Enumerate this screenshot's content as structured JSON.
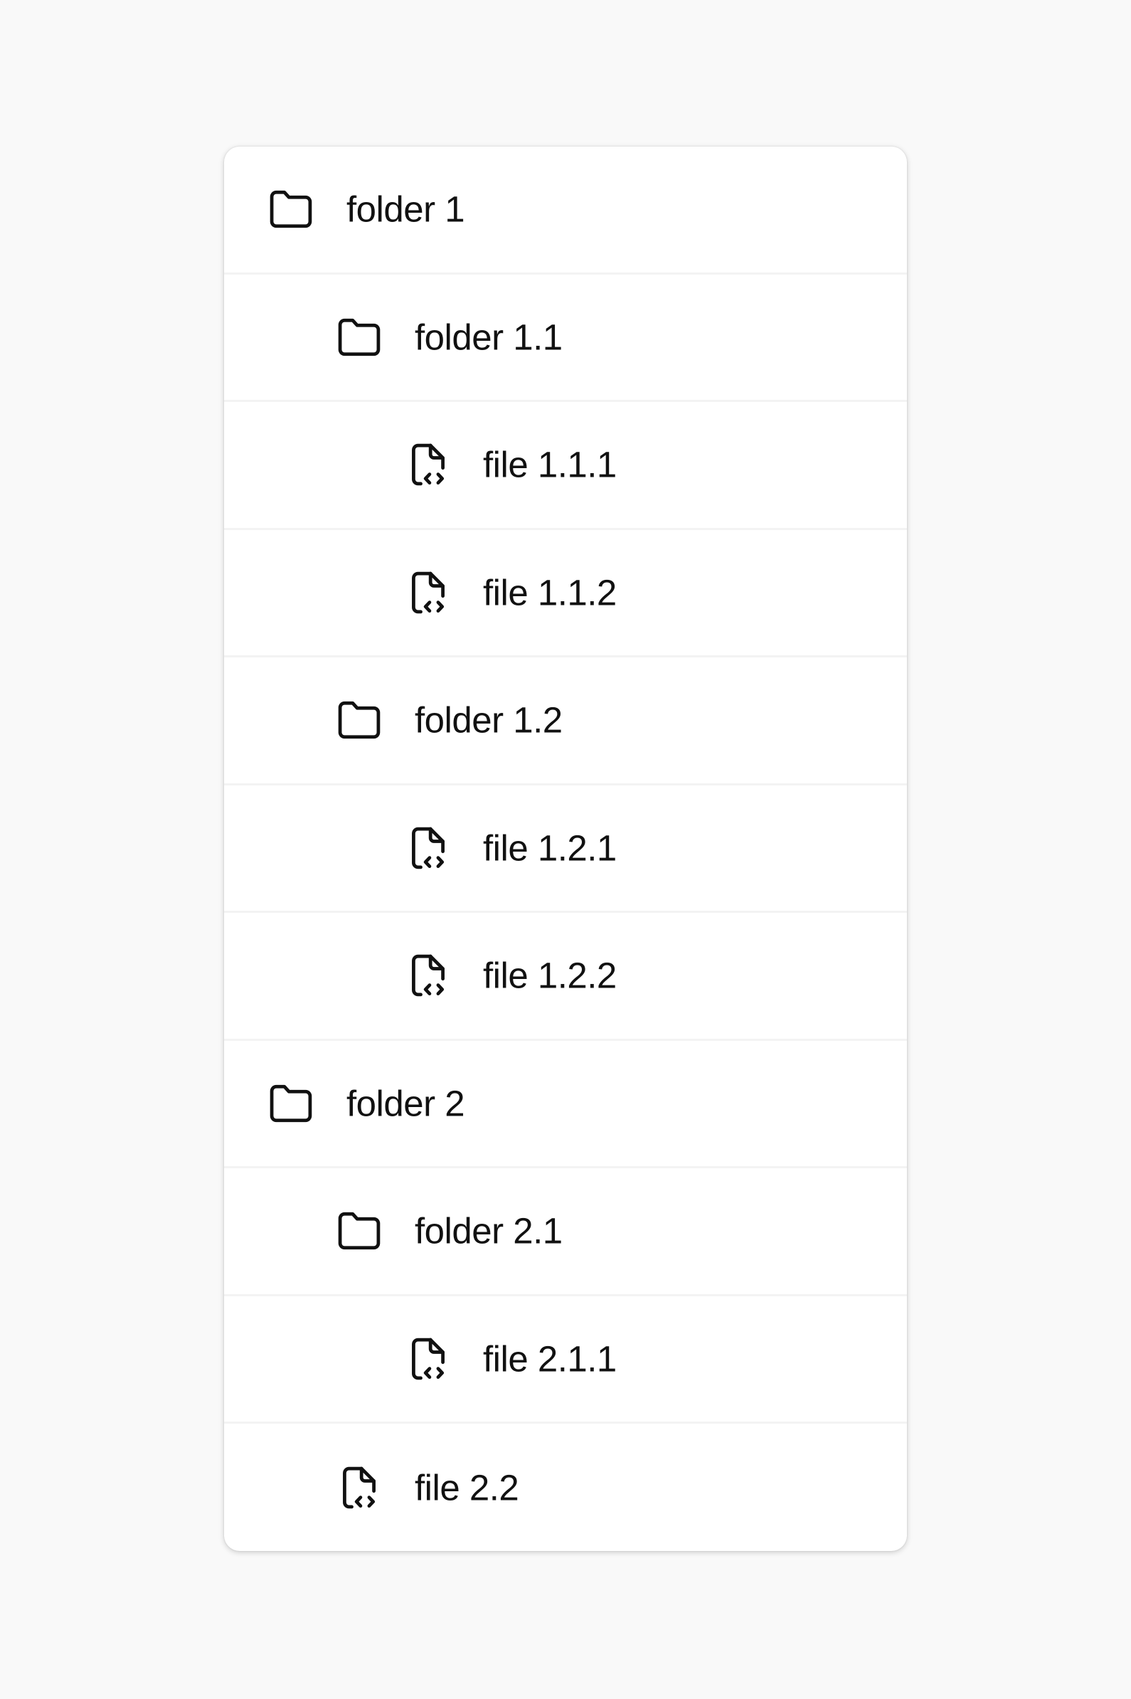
{
  "tree": {
    "items": [
      {
        "label": "folder 1",
        "type": "folder",
        "icon": "folder-icon",
        "level": 0
      },
      {
        "label": "folder 1.1",
        "type": "folder",
        "icon": "folder-icon",
        "level": 1
      },
      {
        "label": "file 1.1.1",
        "type": "file",
        "icon": "file-code-icon",
        "level": 2
      },
      {
        "label": "file 1.1.2",
        "type": "file",
        "icon": "file-code-icon",
        "level": 2
      },
      {
        "label": "folder 1.2",
        "type": "folder",
        "icon": "folder-icon",
        "level": 1
      },
      {
        "label": "file 1.2.1",
        "type": "file",
        "icon": "file-code-icon",
        "level": 2
      },
      {
        "label": "file 1.2.2",
        "type": "file",
        "icon": "file-code-icon",
        "level": 2
      },
      {
        "label": "folder 2",
        "type": "folder",
        "icon": "folder-icon",
        "level": 0
      },
      {
        "label": "folder 2.1",
        "type": "folder",
        "icon": "folder-icon",
        "level": 1
      },
      {
        "label": "file 2.1.1",
        "type": "file",
        "icon": "file-code-icon",
        "level": 2
      },
      {
        "label": "file 2.2",
        "type": "file",
        "icon": "file-code-icon",
        "level": 1
      }
    ]
  },
  "colors": {
    "background": "#f9f9f9",
    "panel": "#ffffff",
    "divider": "#f3f3f3",
    "text": "#111111"
  }
}
